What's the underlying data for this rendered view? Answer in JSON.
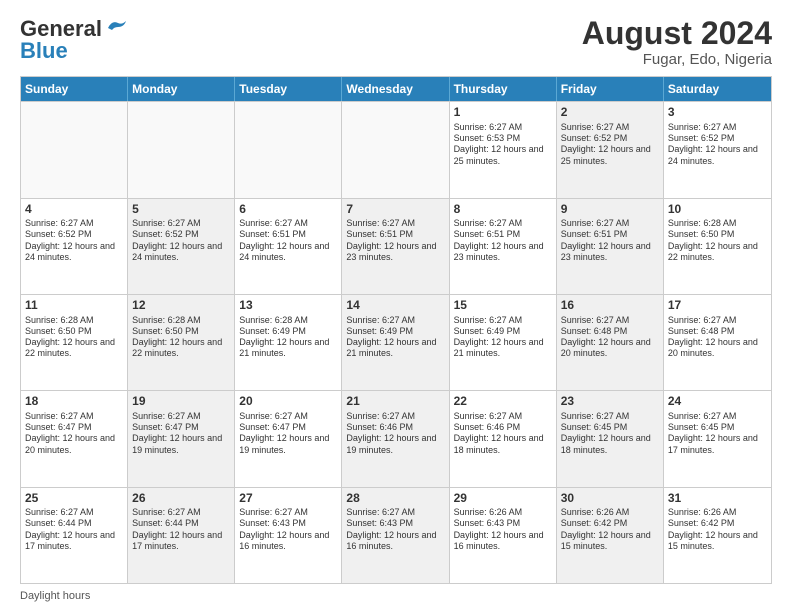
{
  "header": {
    "logo_line1": "General",
    "logo_line2": "Blue",
    "month_year": "August 2024",
    "location": "Fugar, Edo, Nigeria"
  },
  "weekdays": [
    "Sunday",
    "Monday",
    "Tuesday",
    "Wednesday",
    "Thursday",
    "Friday",
    "Saturday"
  ],
  "weeks": [
    [
      {
        "day": "",
        "info": "",
        "shaded": false,
        "empty": true
      },
      {
        "day": "",
        "info": "",
        "shaded": false,
        "empty": true
      },
      {
        "day": "",
        "info": "",
        "shaded": false,
        "empty": true
      },
      {
        "day": "",
        "info": "",
        "shaded": false,
        "empty": true
      },
      {
        "day": "1",
        "info": "Sunrise: 6:27 AM\nSunset: 6:53 PM\nDaylight: 12 hours and 25 minutes.",
        "shaded": false,
        "empty": false
      },
      {
        "day": "2",
        "info": "Sunrise: 6:27 AM\nSunset: 6:52 PM\nDaylight: 12 hours and 25 minutes.",
        "shaded": true,
        "empty": false
      },
      {
        "day": "3",
        "info": "Sunrise: 6:27 AM\nSunset: 6:52 PM\nDaylight: 12 hours and 24 minutes.",
        "shaded": false,
        "empty": false
      }
    ],
    [
      {
        "day": "4",
        "info": "Sunrise: 6:27 AM\nSunset: 6:52 PM\nDaylight: 12 hours and 24 minutes.",
        "shaded": false,
        "empty": false
      },
      {
        "day": "5",
        "info": "Sunrise: 6:27 AM\nSunset: 6:52 PM\nDaylight: 12 hours and 24 minutes.",
        "shaded": true,
        "empty": false
      },
      {
        "day": "6",
        "info": "Sunrise: 6:27 AM\nSunset: 6:51 PM\nDaylight: 12 hours and 24 minutes.",
        "shaded": false,
        "empty": false
      },
      {
        "day": "7",
        "info": "Sunrise: 6:27 AM\nSunset: 6:51 PM\nDaylight: 12 hours and 23 minutes.",
        "shaded": true,
        "empty": false
      },
      {
        "day": "8",
        "info": "Sunrise: 6:27 AM\nSunset: 6:51 PM\nDaylight: 12 hours and 23 minutes.",
        "shaded": false,
        "empty": false
      },
      {
        "day": "9",
        "info": "Sunrise: 6:27 AM\nSunset: 6:51 PM\nDaylight: 12 hours and 23 minutes.",
        "shaded": true,
        "empty": false
      },
      {
        "day": "10",
        "info": "Sunrise: 6:28 AM\nSunset: 6:50 PM\nDaylight: 12 hours and 22 minutes.",
        "shaded": false,
        "empty": false
      }
    ],
    [
      {
        "day": "11",
        "info": "Sunrise: 6:28 AM\nSunset: 6:50 PM\nDaylight: 12 hours and 22 minutes.",
        "shaded": false,
        "empty": false
      },
      {
        "day": "12",
        "info": "Sunrise: 6:28 AM\nSunset: 6:50 PM\nDaylight: 12 hours and 22 minutes.",
        "shaded": true,
        "empty": false
      },
      {
        "day": "13",
        "info": "Sunrise: 6:28 AM\nSunset: 6:49 PM\nDaylight: 12 hours and 21 minutes.",
        "shaded": false,
        "empty": false
      },
      {
        "day": "14",
        "info": "Sunrise: 6:27 AM\nSunset: 6:49 PM\nDaylight: 12 hours and 21 minutes.",
        "shaded": true,
        "empty": false
      },
      {
        "day": "15",
        "info": "Sunrise: 6:27 AM\nSunset: 6:49 PM\nDaylight: 12 hours and 21 minutes.",
        "shaded": false,
        "empty": false
      },
      {
        "day": "16",
        "info": "Sunrise: 6:27 AM\nSunset: 6:48 PM\nDaylight: 12 hours and 20 minutes.",
        "shaded": true,
        "empty": false
      },
      {
        "day": "17",
        "info": "Sunrise: 6:27 AM\nSunset: 6:48 PM\nDaylight: 12 hours and 20 minutes.",
        "shaded": false,
        "empty": false
      }
    ],
    [
      {
        "day": "18",
        "info": "Sunrise: 6:27 AM\nSunset: 6:47 PM\nDaylight: 12 hours and 20 minutes.",
        "shaded": false,
        "empty": false
      },
      {
        "day": "19",
        "info": "Sunrise: 6:27 AM\nSunset: 6:47 PM\nDaylight: 12 hours and 19 minutes.",
        "shaded": true,
        "empty": false
      },
      {
        "day": "20",
        "info": "Sunrise: 6:27 AM\nSunset: 6:47 PM\nDaylight: 12 hours and 19 minutes.",
        "shaded": false,
        "empty": false
      },
      {
        "day": "21",
        "info": "Sunrise: 6:27 AM\nSunset: 6:46 PM\nDaylight: 12 hours and 19 minutes.",
        "shaded": true,
        "empty": false
      },
      {
        "day": "22",
        "info": "Sunrise: 6:27 AM\nSunset: 6:46 PM\nDaylight: 12 hours and 18 minutes.",
        "shaded": false,
        "empty": false
      },
      {
        "day": "23",
        "info": "Sunrise: 6:27 AM\nSunset: 6:45 PM\nDaylight: 12 hours and 18 minutes.",
        "shaded": true,
        "empty": false
      },
      {
        "day": "24",
        "info": "Sunrise: 6:27 AM\nSunset: 6:45 PM\nDaylight: 12 hours and 17 minutes.",
        "shaded": false,
        "empty": false
      }
    ],
    [
      {
        "day": "25",
        "info": "Sunrise: 6:27 AM\nSunset: 6:44 PM\nDaylight: 12 hours and 17 minutes.",
        "shaded": false,
        "empty": false
      },
      {
        "day": "26",
        "info": "Sunrise: 6:27 AM\nSunset: 6:44 PM\nDaylight: 12 hours and 17 minutes.",
        "shaded": true,
        "empty": false
      },
      {
        "day": "27",
        "info": "Sunrise: 6:27 AM\nSunset: 6:43 PM\nDaylight: 12 hours and 16 minutes.",
        "shaded": false,
        "empty": false
      },
      {
        "day": "28",
        "info": "Sunrise: 6:27 AM\nSunset: 6:43 PM\nDaylight: 12 hours and 16 minutes.",
        "shaded": true,
        "empty": false
      },
      {
        "day": "29",
        "info": "Sunrise: 6:26 AM\nSunset: 6:43 PM\nDaylight: 12 hours and 16 minutes.",
        "shaded": false,
        "empty": false
      },
      {
        "day": "30",
        "info": "Sunrise: 6:26 AM\nSunset: 6:42 PM\nDaylight: 12 hours and 15 minutes.",
        "shaded": true,
        "empty": false
      },
      {
        "day": "31",
        "info": "Sunrise: 6:26 AM\nSunset: 6:42 PM\nDaylight: 12 hours and 15 minutes.",
        "shaded": false,
        "empty": false
      }
    ]
  ],
  "footer": {
    "note": "Daylight hours"
  }
}
